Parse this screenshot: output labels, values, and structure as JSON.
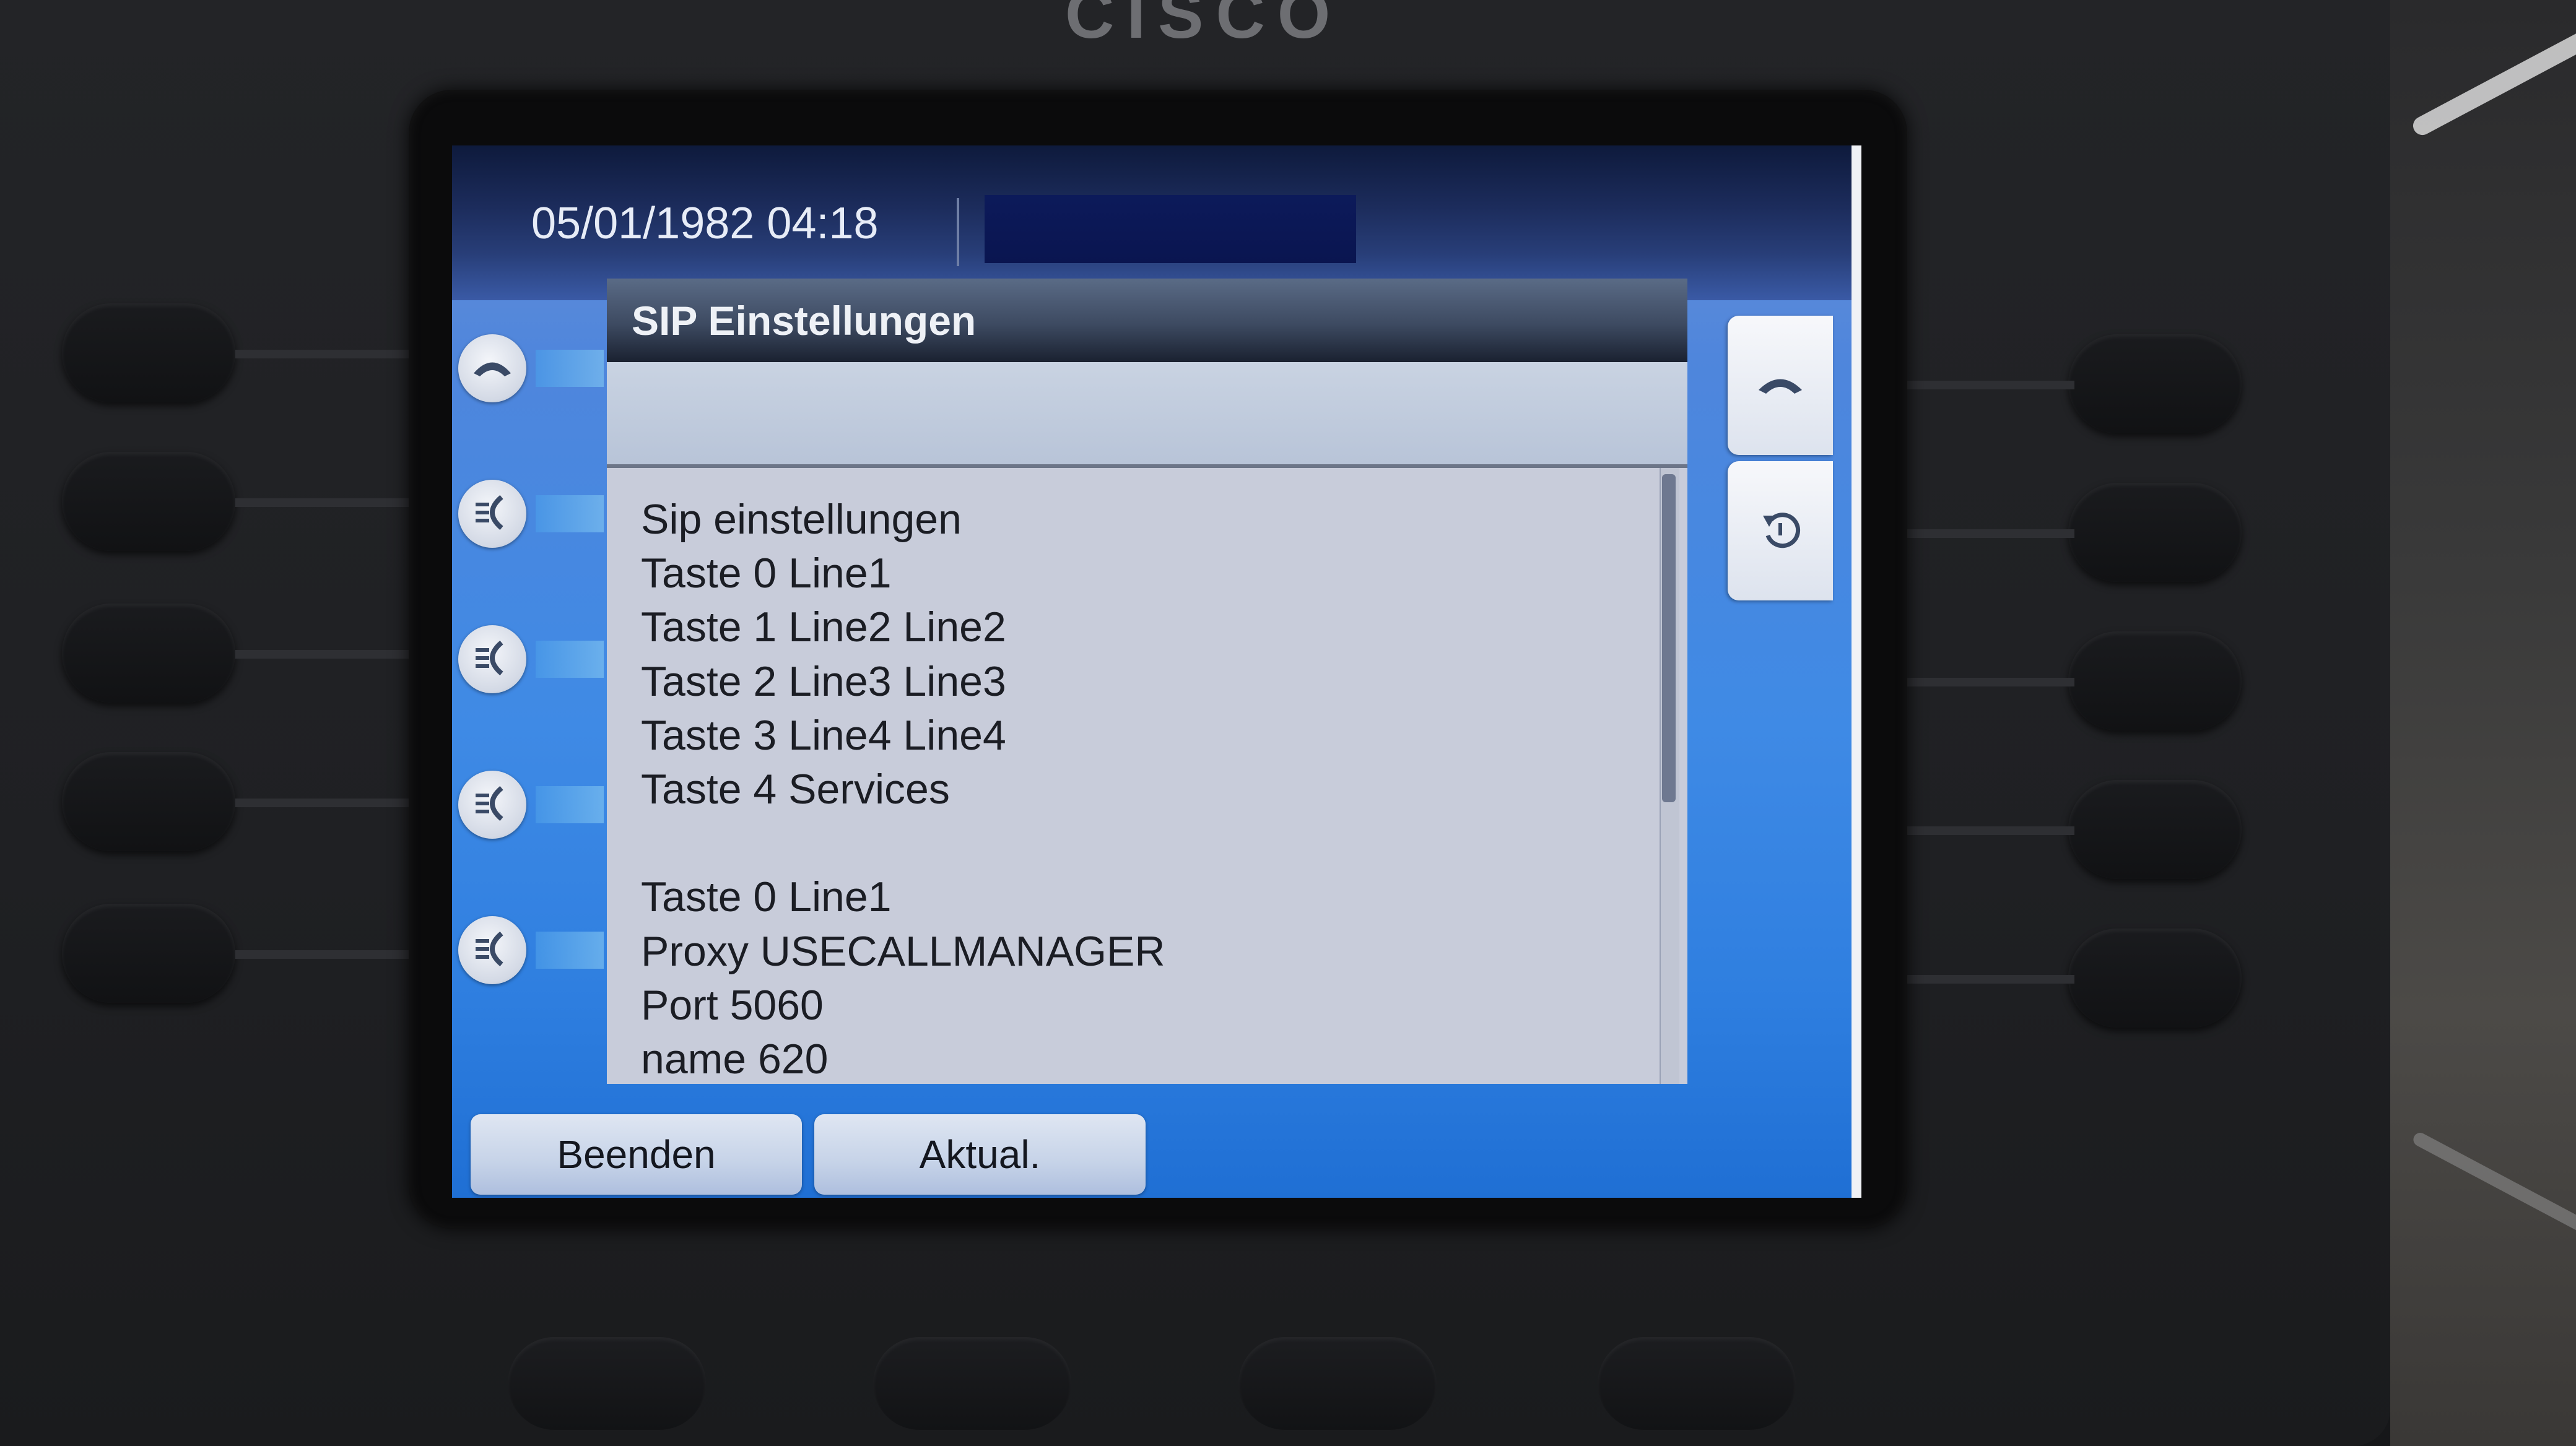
{
  "device": {
    "brand_text": "CISCO"
  },
  "status_bar": {
    "datetime": "05/01/1982 04:18"
  },
  "dialog": {
    "title": "SIP Einstellungen",
    "input_value": "",
    "lines": [
      "Sip einstellungen",
      "Taste 0 Line1",
      "Taste 1 Line2 Line2",
      "Taste 2 Line3 Line3",
      "Taste 3 Line4 Line4",
      "Taste 4 Services",
      "",
      "Taste 0 Line1",
      "Proxy USECALLMANAGER",
      "Port 5060",
      "name 620"
    ]
  },
  "softkeys": {
    "exit_label": "Beenden",
    "update_label": "Aktual."
  },
  "line_keys": [
    {
      "icon": "handset-icon"
    },
    {
      "icon": "speed-dial-icon"
    },
    {
      "icon": "speed-dial-icon"
    },
    {
      "icon": "speed-dial-icon"
    },
    {
      "icon": "speed-dial-icon"
    }
  ],
  "session_keys": [
    {
      "icon": "handset-icon"
    },
    {
      "icon": "back-arrow-icon"
    }
  ],
  "colors": {
    "screen_blue": "#3f8ae5",
    "title_bar": "#3d4a61",
    "list_bg": "#c8ccda",
    "softkey_bg": "#c6d3e8"
  }
}
